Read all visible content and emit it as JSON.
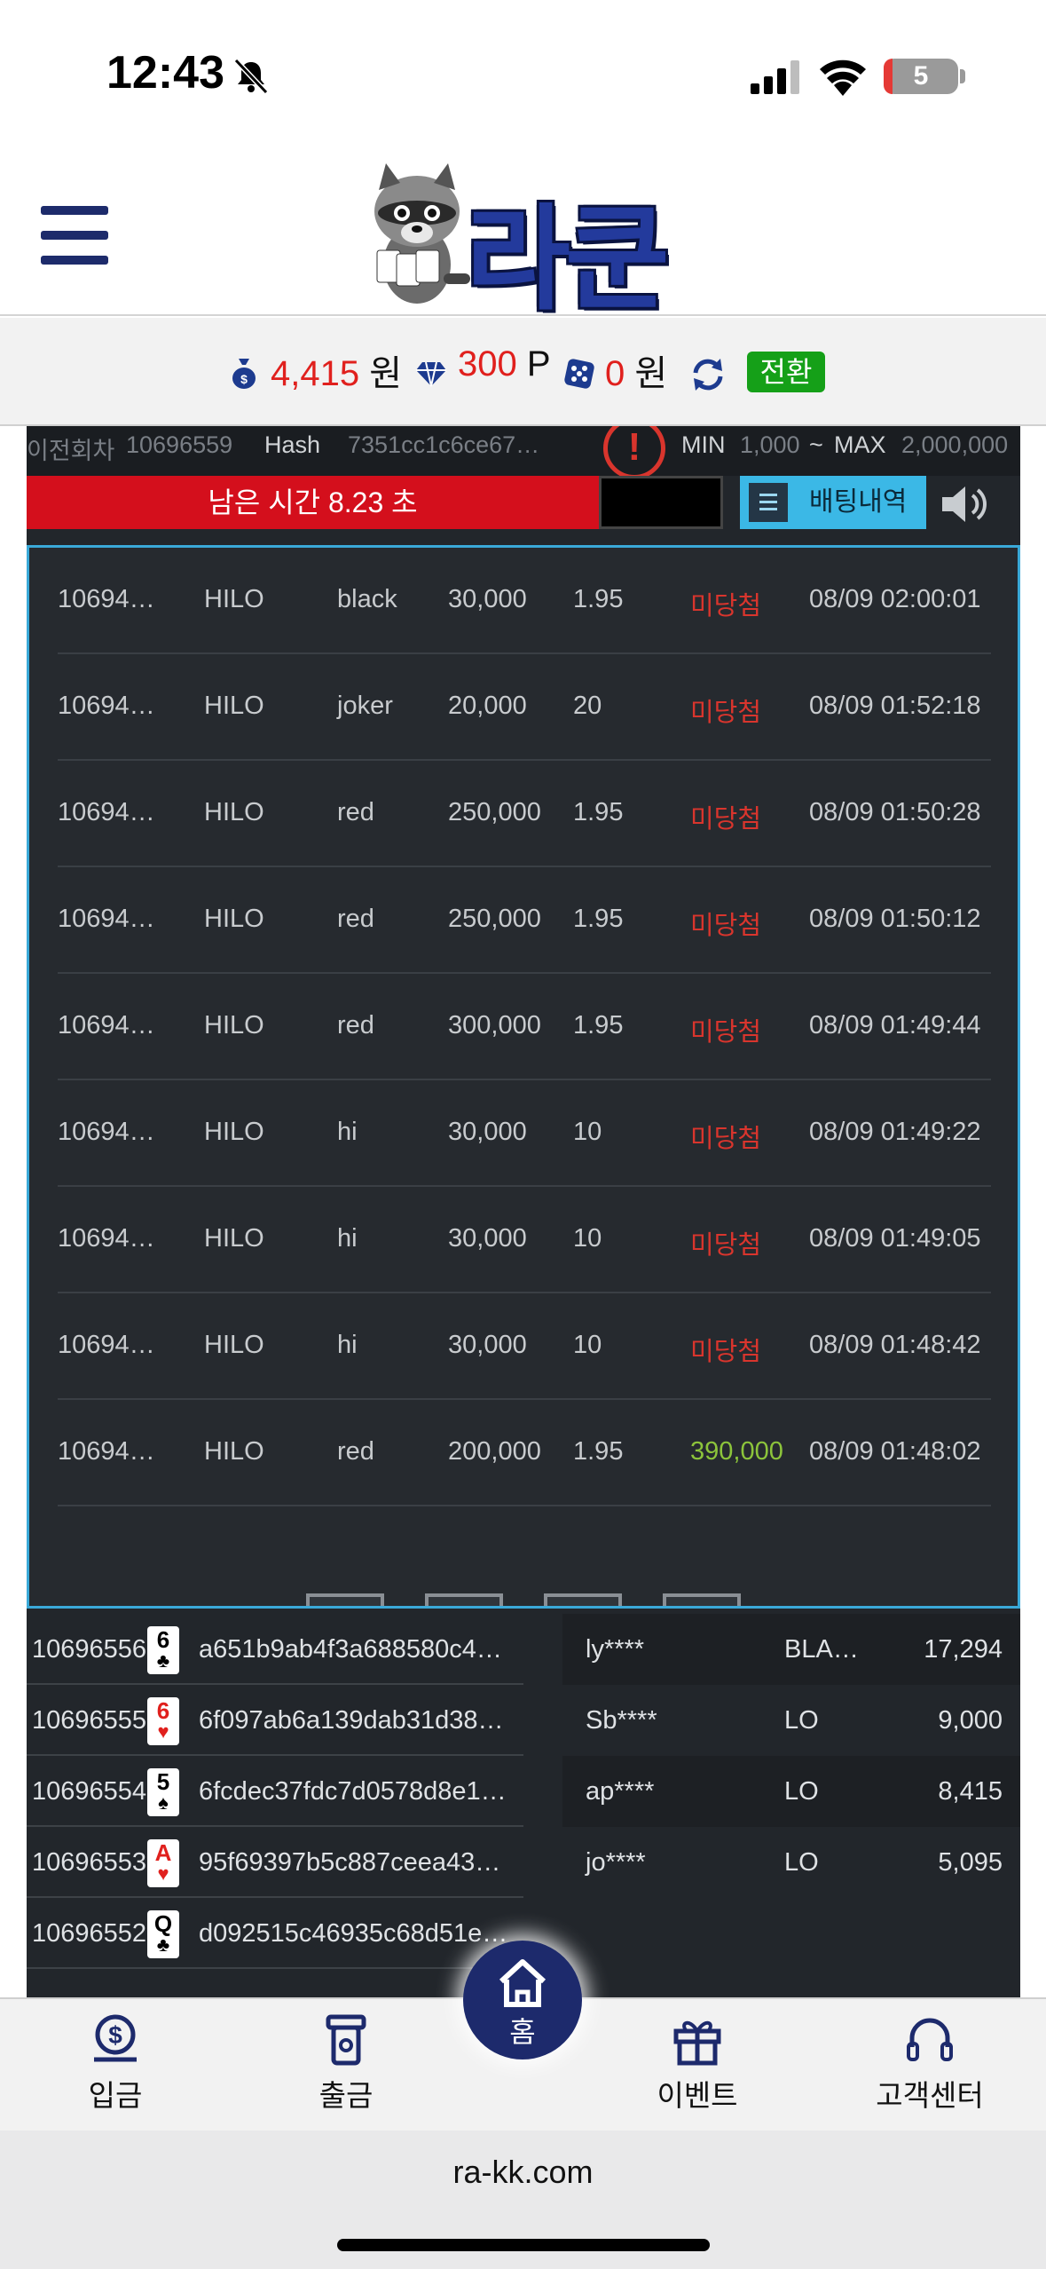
{
  "status": {
    "time": "12:43",
    "battery": "5"
  },
  "header": {
    "logo_text": "라쿤"
  },
  "balance": {
    "money_value": "4,415",
    "money_unit": "원",
    "point_value": "300",
    "point_unit": "P",
    "casino_value": "0",
    "casino_unit": "원",
    "convert_label": "전환"
  },
  "game": {
    "info": {
      "prev_round_label": "이전회차",
      "prev_round_value": "10696559",
      "hash_label": "Hash",
      "hash_value": "7351cc1c6ce67…",
      "min_label": "MIN",
      "min_value": "1,000",
      "sep": "~",
      "max_label": "MAX",
      "max_value": "2,000,000"
    },
    "timer_text": "남은 시간 8.23 초",
    "bet_history_label": "배팅내역"
  },
  "bet_history": [
    {
      "round": "10694…",
      "game": "HILO",
      "pick": "black",
      "amount": "30,000",
      "odds": "1.95",
      "result": "미당첨",
      "win": false,
      "time": "08/09 02:00:01"
    },
    {
      "round": "10694…",
      "game": "HILO",
      "pick": "joker",
      "amount": "20,000",
      "odds": "20",
      "result": "미당첨",
      "win": false,
      "time": "08/09 01:52:18"
    },
    {
      "round": "10694…",
      "game": "HILO",
      "pick": "red",
      "amount": "250,000",
      "odds": "1.95",
      "result": "미당첨",
      "win": false,
      "time": "08/09 01:50:28"
    },
    {
      "round": "10694…",
      "game": "HILO",
      "pick": "red",
      "amount": "250,000",
      "odds": "1.95",
      "result": "미당첨",
      "win": false,
      "time": "08/09 01:50:12"
    },
    {
      "round": "10694…",
      "game": "HILO",
      "pick": "red",
      "amount": "300,000",
      "odds": "1.95",
      "result": "미당첨",
      "win": false,
      "time": "08/09 01:49:44"
    },
    {
      "round": "10694…",
      "game": "HILO",
      "pick": "hi",
      "amount": "30,000",
      "odds": "10",
      "result": "미당첨",
      "win": false,
      "time": "08/09 01:49:22"
    },
    {
      "round": "10694…",
      "game": "HILO",
      "pick": "hi",
      "amount": "30,000",
      "odds": "10",
      "result": "미당첨",
      "win": false,
      "time": "08/09 01:49:05"
    },
    {
      "round": "10694…",
      "game": "HILO",
      "pick": "hi",
      "amount": "30,000",
      "odds": "10",
      "result": "미당첨",
      "win": false,
      "time": "08/09 01:48:42"
    },
    {
      "round": "10694…",
      "game": "HILO",
      "pick": "red",
      "amount": "200,000",
      "odds": "1.95",
      "result": "390,000",
      "win": true,
      "time": "08/09 01:48:02"
    }
  ],
  "round_results": [
    {
      "round": "10696556",
      "card_rank": "6",
      "card_suit": "♣",
      "card_color": "#000000",
      "hash": "a651b9ab4f3a688580c4…"
    },
    {
      "round": "10696555",
      "card_rank": "6",
      "card_suit": "♥",
      "card_color": "#e0201d",
      "hash": "6f097ab6a139dab31d38…"
    },
    {
      "round": "10696554",
      "card_rank": "5",
      "card_suit": "♠",
      "card_color": "#000000",
      "hash": "6fcdec37fdc7d0578d8e1…"
    },
    {
      "round": "10696553",
      "card_rank": "A",
      "card_suit": "♥",
      "card_color": "#e0201d",
      "hash": "95f69397b5c887ceea43…"
    },
    {
      "round": "10696552",
      "card_rank": "Q",
      "card_suit": "♣",
      "card_color": "#000000",
      "hash": "d092515c46935c68d51e…"
    }
  ],
  "live_bets": [
    {
      "user": "ly****",
      "pick": "BLA…",
      "amount": "17,294"
    },
    {
      "user": "Sb****",
      "pick": "LO",
      "amount": "9,000"
    },
    {
      "user": "ap****",
      "pick": "LO",
      "amount": "8,415"
    },
    {
      "user": "jo****",
      "pick": "LO",
      "amount": "5,095"
    }
  ],
  "tabs": {
    "deposit": "입금",
    "withdraw": "출금",
    "home": "홈",
    "event": "이벤트",
    "support": "고객센터"
  },
  "browser": {
    "url": "ra-kk.com"
  },
  "colors": {
    "brand_navy": "#1d2a6c",
    "timer_red": "#d40f1c",
    "accent_cyan": "#3bb8e6",
    "lose_red": "#d9352d",
    "win_green": "#8cc43b",
    "convert_green": "#15a018"
  }
}
